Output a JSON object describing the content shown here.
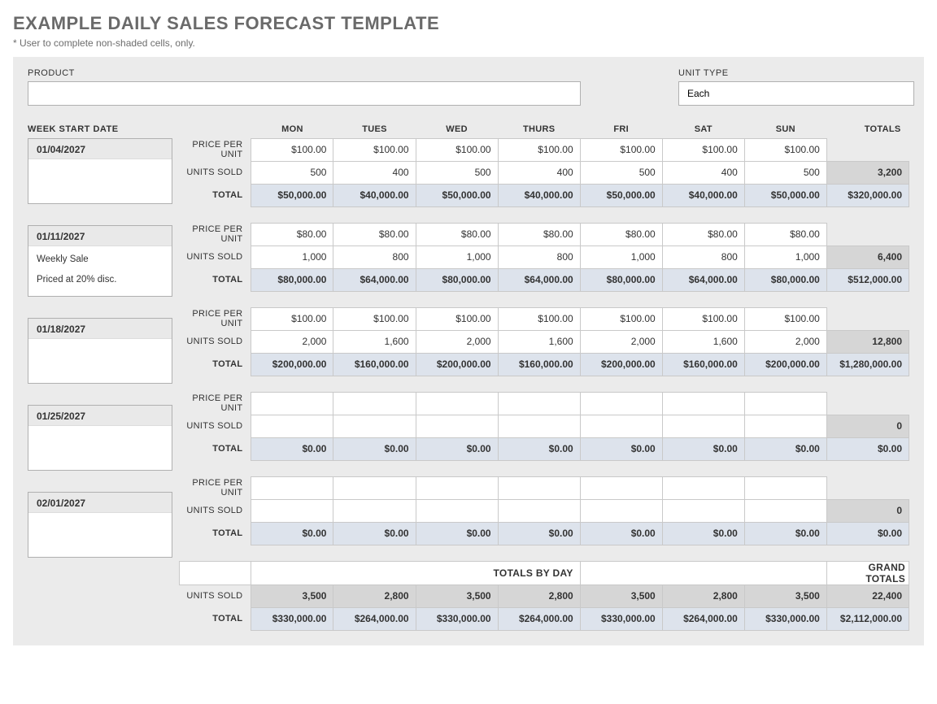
{
  "title": "EXAMPLE DAILY SALES FORECAST TEMPLATE",
  "subtitle": "* User to complete non-shaded cells, only.",
  "labels": {
    "product": "PRODUCT",
    "unit_type": "UNIT TYPE",
    "week_start": "WEEK START DATE",
    "price_per_unit": "PRICE PER UNIT",
    "units_sold": "UNITS SOLD",
    "total": "TOTAL",
    "totals": "TOTALS",
    "totals_by_day": "TOTALS BY DAY",
    "grand_totals": "GRAND TOTALS"
  },
  "inputs": {
    "product": "",
    "unit_type": "Each"
  },
  "days": [
    "MON",
    "TUES",
    "WED",
    "THURS",
    "FRI",
    "SAT",
    "SUN"
  ],
  "weeks": [
    {
      "date": "01/04/2027",
      "notes": [],
      "price": [
        "$100.00",
        "$100.00",
        "$100.00",
        "$100.00",
        "$100.00",
        "$100.00",
        "$100.00"
      ],
      "units": [
        "500",
        "400",
        "500",
        "400",
        "500",
        "400",
        "500"
      ],
      "units_total": "3,200",
      "totals": [
        "$50,000.00",
        "$40,000.00",
        "$50,000.00",
        "$40,000.00",
        "$50,000.00",
        "$40,000.00",
        "$50,000.00"
      ],
      "row_total": "$320,000.00"
    },
    {
      "date": "01/11/2027",
      "notes": [
        "Weekly Sale",
        "Priced at 20% disc."
      ],
      "price": [
        "$80.00",
        "$80.00",
        "$80.00",
        "$80.00",
        "$80.00",
        "$80.00",
        "$80.00"
      ],
      "units": [
        "1,000",
        "800",
        "1,000",
        "800",
        "1,000",
        "800",
        "1,000"
      ],
      "units_total": "6,400",
      "totals": [
        "$80,000.00",
        "$64,000.00",
        "$80,000.00",
        "$64,000.00",
        "$80,000.00",
        "$64,000.00",
        "$80,000.00"
      ],
      "row_total": "$512,000.00"
    },
    {
      "date": "01/18/2027",
      "notes": [],
      "price": [
        "$100.00",
        "$100.00",
        "$100.00",
        "$100.00",
        "$100.00",
        "$100.00",
        "$100.00"
      ],
      "units": [
        "2,000",
        "1,600",
        "2,000",
        "1,600",
        "2,000",
        "1,600",
        "2,000"
      ],
      "units_total": "12,800",
      "totals": [
        "$200,000.00",
        "$160,000.00",
        "$200,000.00",
        "$160,000.00",
        "$200,000.00",
        "$160,000.00",
        "$200,000.00"
      ],
      "row_total": "$1,280,000.00"
    },
    {
      "date": "01/25/2027",
      "notes": [],
      "price": [
        "",
        "",
        "",
        "",
        "",
        "",
        ""
      ],
      "units": [
        "",
        "",
        "",
        "",
        "",
        "",
        ""
      ],
      "units_total": "0",
      "totals": [
        "$0.00",
        "$0.00",
        "$0.00",
        "$0.00",
        "$0.00",
        "$0.00",
        "$0.00"
      ],
      "row_total": "$0.00"
    },
    {
      "date": "02/01/2027",
      "notes": [],
      "price": [
        "",
        "",
        "",
        "",
        "",
        "",
        ""
      ],
      "units": [
        "",
        "",
        "",
        "",
        "",
        "",
        ""
      ],
      "units_total": "0",
      "totals": [
        "$0.00",
        "$0.00",
        "$0.00",
        "$0.00",
        "$0.00",
        "$0.00",
        "$0.00"
      ],
      "row_total": "$0.00"
    }
  ],
  "day_totals": {
    "units": [
      "3,500",
      "2,800",
      "3,500",
      "2,800",
      "3,500",
      "2,800",
      "3,500"
    ],
    "units_grand": "22,400",
    "money": [
      "$330,000.00",
      "$264,000.00",
      "$330,000.00",
      "$264,000.00",
      "$330,000.00",
      "$264,000.00",
      "$330,000.00"
    ],
    "money_grand": "$2,112,000.00"
  }
}
